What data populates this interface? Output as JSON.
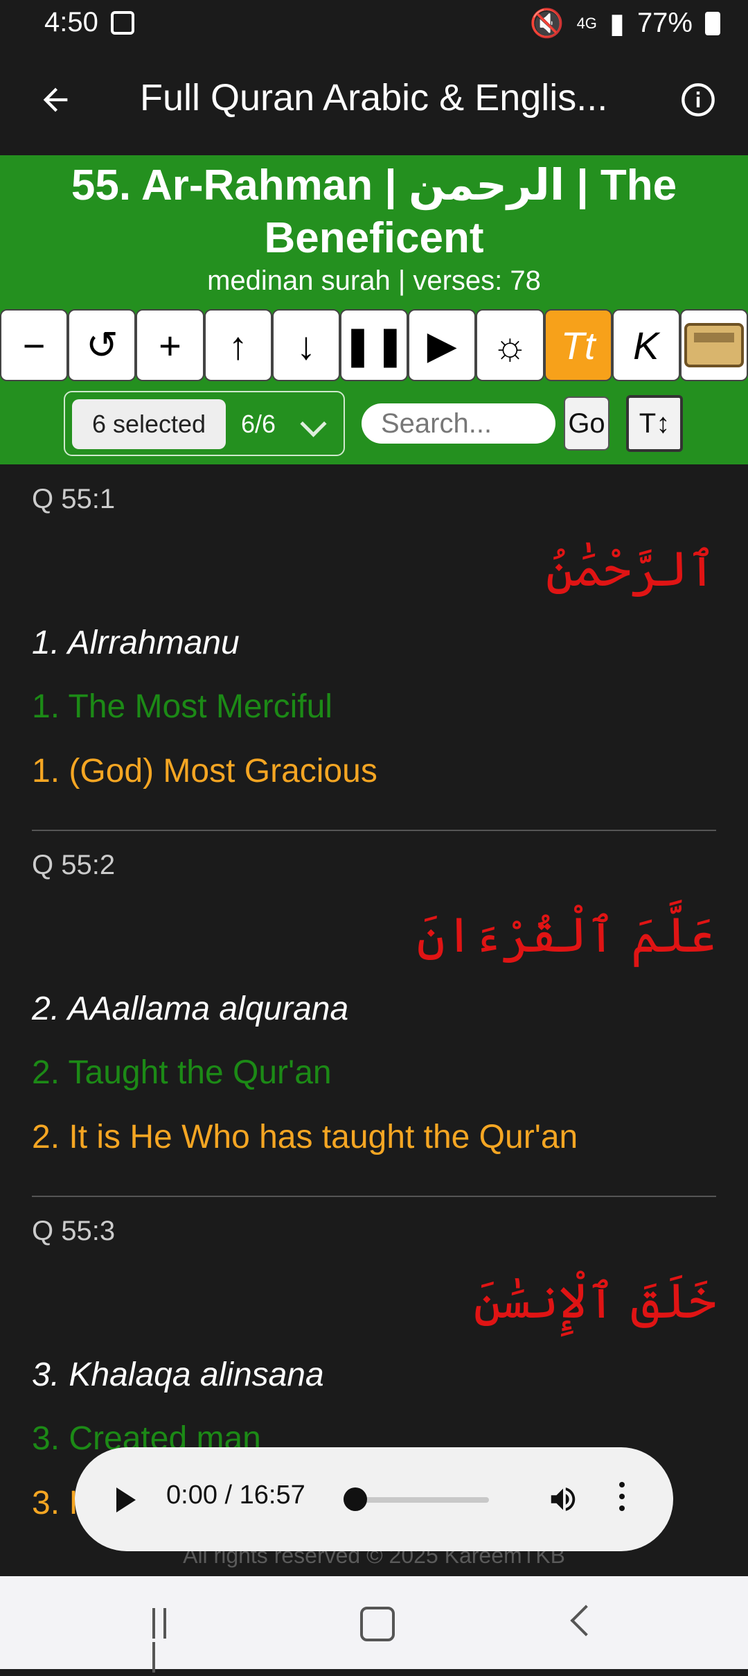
{
  "status": {
    "time": "4:50",
    "battery": "77%",
    "network": "4G"
  },
  "appbar": {
    "title": "Full Quran Arabic & Englis..."
  },
  "surah": {
    "name": "55. Ar-Rahman | الرحمن | The Beneficent",
    "subtitle": "medinan surah | verses: 78"
  },
  "toolbar": {
    "minus": "−",
    "reset": "↺",
    "plus": "+",
    "up": "↑",
    "down": "↓",
    "pause": "❚❚",
    "flag": "▶",
    "brightness": "☼",
    "tt": "Tt",
    "k": "K"
  },
  "controls": {
    "selected": "6 selected",
    "count": "6/6",
    "search_placeholder": "Search...",
    "go": "Go",
    "text_size": "T↕"
  },
  "verses": [
    {
      "ref": "Q 55:1",
      "arabic": "ٱلرَّحْمَٰنُ",
      "translit": "1. Alrrahmanu",
      "en1": "1. The Most Merciful",
      "en2": "1. (God) Most Gracious"
    },
    {
      "ref": "Q 55:2",
      "arabic": "عَلَّمَ ٱلْقُرْءَانَ",
      "translit": "2. AAallama alqurana",
      "en1": "2. Taught the Qur'an",
      "en2": "2. It is He Who has taught the Qur'an"
    },
    {
      "ref": "Q 55:3",
      "arabic": "خَلَقَ ٱلْإِنسَٰنَ",
      "translit": "3. Khalaqa alinsana",
      "en1": "3. Created man",
      "en2": "3. I"
    }
  ],
  "footer": {
    "text": "All rights reserved © 2025 KareemTKB"
  },
  "audio": {
    "time": "0:00 / 16:57",
    "progress": 0
  }
}
